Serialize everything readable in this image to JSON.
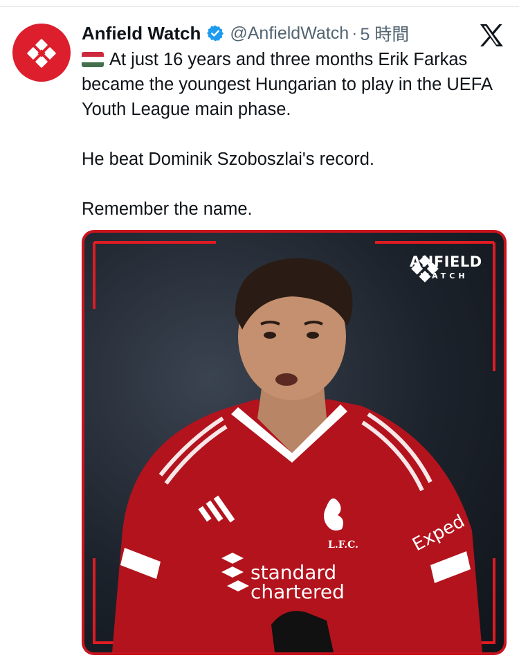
{
  "author": {
    "name": "Anfield Watch",
    "handle": "@AnfieldWatch",
    "separator": "·",
    "time": "5 時間",
    "avatar_icon": "anfield-watch-logo-icon",
    "verified_icon": "verified-badge-icon",
    "brand_color": "#dc1e2d",
    "verified_color": "#1d9bf0"
  },
  "platform_icon": "x-logo-icon",
  "tweet": {
    "flag_icon": "hungary-flag-icon",
    "paragraph1": "At just 16 years and three months Erik Farkas became the youngest Hungarian to play in the UEFA Youth League main phase.",
    "paragraph2": "He beat Dominik Szoboszlai's record.",
    "paragraph3": "Remember the name."
  },
  "media": {
    "frame_color": "#c8141e",
    "watermark_title": "ANFIELD",
    "watermark_subtitle": "WATCH",
    "shirt_sponsor_line1": "standard",
    "shirt_sponsor_line2": "chartered",
    "shirt_crest_text": "L.F.C.",
    "sleeve_sponsor": "Exped"
  }
}
